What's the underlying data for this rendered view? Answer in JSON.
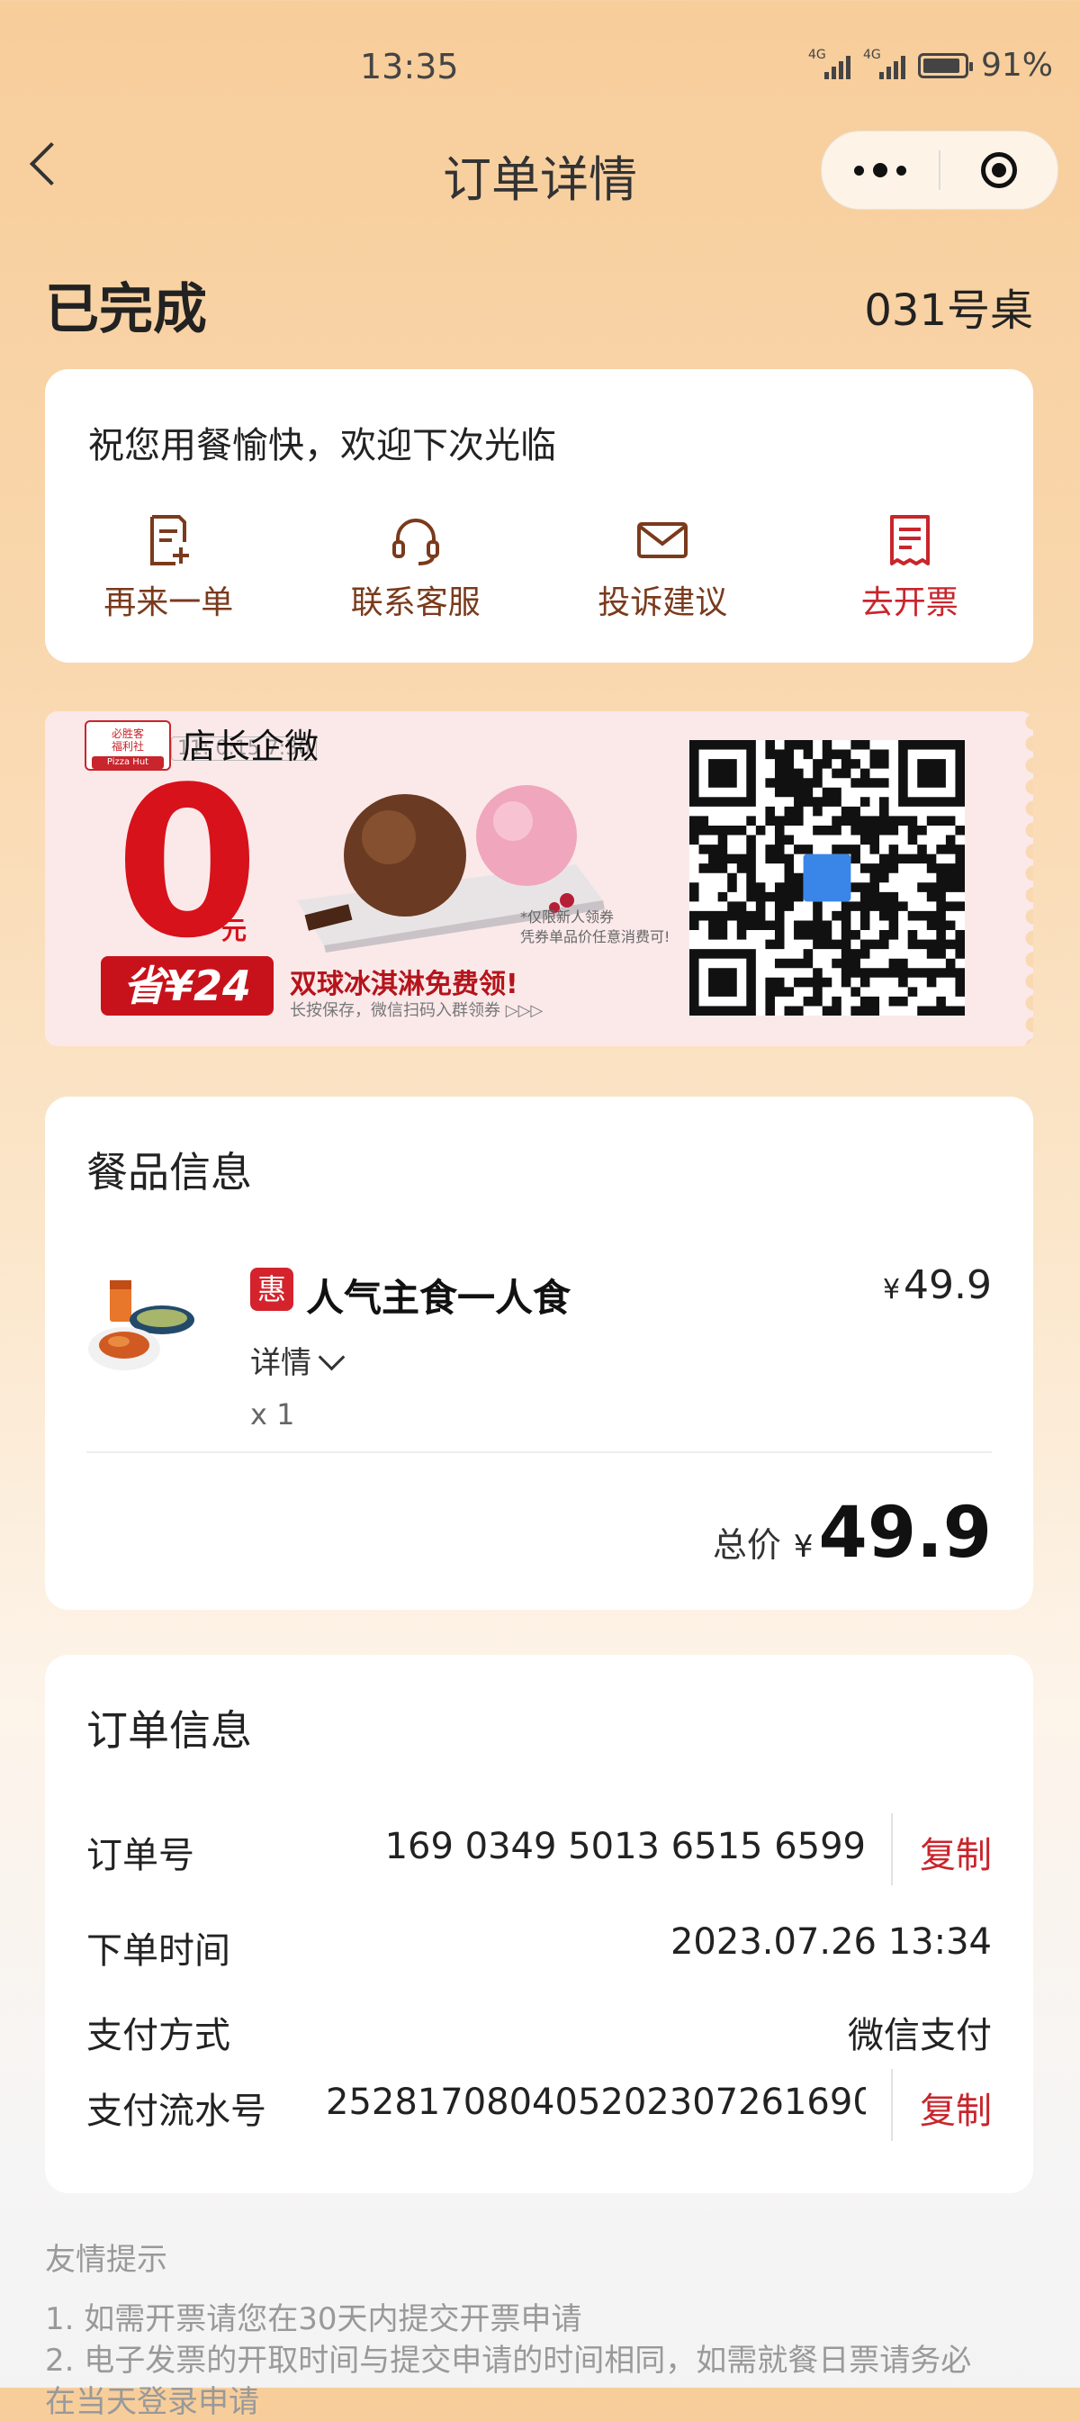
{
  "status_bar": {
    "time": "13:35",
    "battery": "91%",
    "net1": "4G",
    "net2": "4G"
  },
  "nav": {
    "title": "订单详情"
  },
  "order_status": "已完成",
  "table_number": "031号桌",
  "greeting": "祝您用餐愉快，欢迎下次光临",
  "actions": [
    {
      "label": "再来一单",
      "icon": "reorder-icon"
    },
    {
      "label": "联系客服",
      "icon": "headset-icon"
    },
    {
      "label": "投诉建议",
      "icon": "mail-icon"
    },
    {
      "label": "去开票",
      "icon": "invoice-icon"
    }
  ],
  "banner": {
    "badge_line1": "必胜客",
    "badge_line2": "福利社",
    "badge_brand": "Pizza Hut",
    "title": "店长企微",
    "subtitle": "11: 0:15 7:30",
    "price": "0",
    "yuan": "元",
    "save": "省¥24",
    "promo": "双球冰淇淋免费领!",
    "hint": "长按保存，微信扫码入群领券 ▷▷▷",
    "note1": "*仅限新人领券",
    "note2": "凭券单品价任意消费可!"
  },
  "food": {
    "section_title": "餐品信息",
    "badge": "惠",
    "name": "人气主食一人食",
    "currency": "¥",
    "price": "49.9",
    "detail_label": "详情",
    "qty": "x 1",
    "total_label": "总价",
    "total_currency": "¥",
    "total": "49.9"
  },
  "order_info": {
    "section_title": "订单信息",
    "order_no_label": "订单号",
    "order_no": "169 0349 5013 6515 6599",
    "copy_label": "复制",
    "time_label": "下单时间",
    "time": "2023.07.26 13:34",
    "pay_label": "支付方式",
    "pay": "微信支付",
    "serial_label": "支付流水号",
    "serial": "252817080405202307261690…"
  },
  "tips": {
    "title": "友情提示",
    "line1": "1. 如需开票请您在30天内提交开票申请",
    "line2": "2. 电子发票的开取时间与提交申请的时间相同，如需就餐日票请务必",
    "line3": "在当天登录申请"
  }
}
